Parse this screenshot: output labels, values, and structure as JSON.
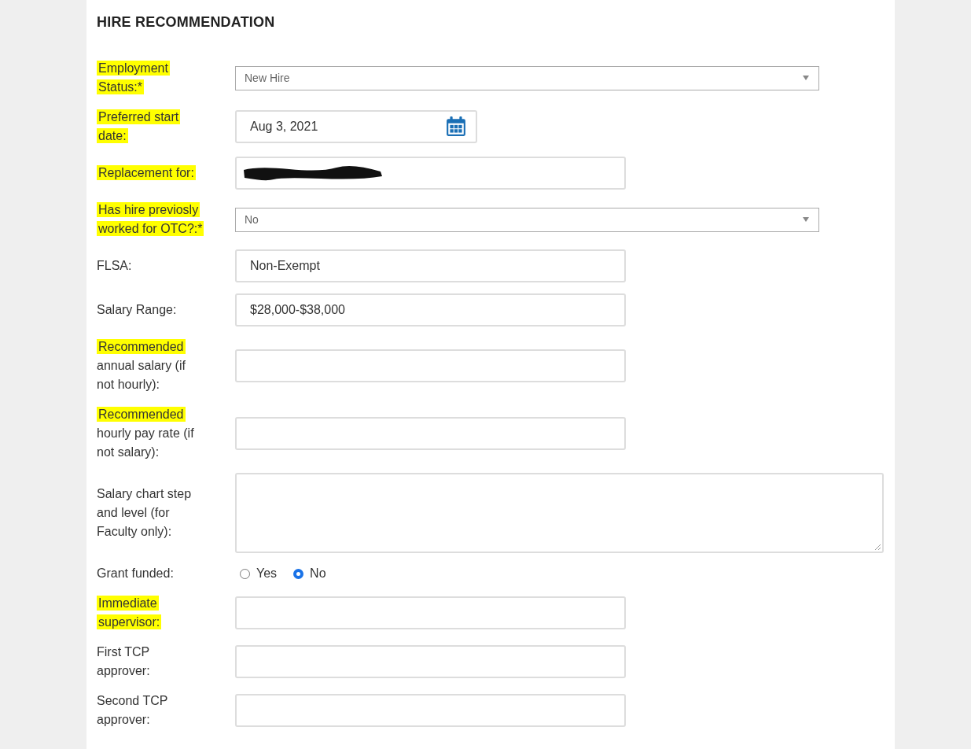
{
  "section": {
    "title": "HIRE RECOMMENDATION"
  },
  "fields": [
    {
      "kind": "select",
      "label": [
        {
          "text": "Employment Status:*",
          "highlighted": true
        }
      ],
      "value": "New Hire"
    },
    {
      "kind": "date",
      "label": [
        {
          "text": "Preferred start date:",
          "highlighted": true
        }
      ],
      "value": "Aug 3, 2021"
    },
    {
      "kind": "text",
      "label": [
        {
          "text": "Replacement for:",
          "highlighted": true
        }
      ],
      "redacted": true
    },
    {
      "kind": "select",
      "label": [
        {
          "text": "Has hire previosly worked for OTC?:*",
          "highlighted": true
        }
      ],
      "value": "No"
    },
    {
      "kind": "text",
      "label": [
        {
          "text": "FLSA:",
          "highlighted": false
        }
      ],
      "value": "Non-Exempt"
    },
    {
      "kind": "text",
      "label": [
        {
          "text": "Salary Range:",
          "highlighted": false
        }
      ],
      "value": "$28,000-$38,000"
    },
    {
      "kind": "text",
      "label": [
        {
          "text": "Recommended",
          "highlighted": true
        },
        {
          "text": "annual salary (if not hourly):",
          "highlighted": false
        }
      ]
    },
    {
      "kind": "text",
      "label": [
        {
          "text": "Recommended",
          "highlighted": true
        },
        {
          "text": "hourly pay rate (if not salary):",
          "highlighted": false
        }
      ]
    },
    {
      "kind": "textarea",
      "label": [
        {
          "text": "Salary chart step and level (for Faculty only):",
          "highlighted": false
        }
      ]
    },
    {
      "kind": "radio",
      "label": [
        {
          "text": "Grant funded:",
          "highlighted": false
        }
      ],
      "options": [
        {
          "label": "Yes",
          "selected": false
        },
        {
          "label": "No",
          "selected": true
        }
      ]
    },
    {
      "kind": "text",
      "label": [
        {
          "text": "Immediate supervisor:",
          "highlighted": true
        }
      ]
    },
    {
      "kind": "text",
      "label": [
        {
          "text": "First TCP approver:",
          "highlighted": false
        }
      ]
    },
    {
      "kind": "text",
      "label": [
        {
          "text": "Second TCP approver:",
          "highlighted": false
        }
      ]
    }
  ]
}
